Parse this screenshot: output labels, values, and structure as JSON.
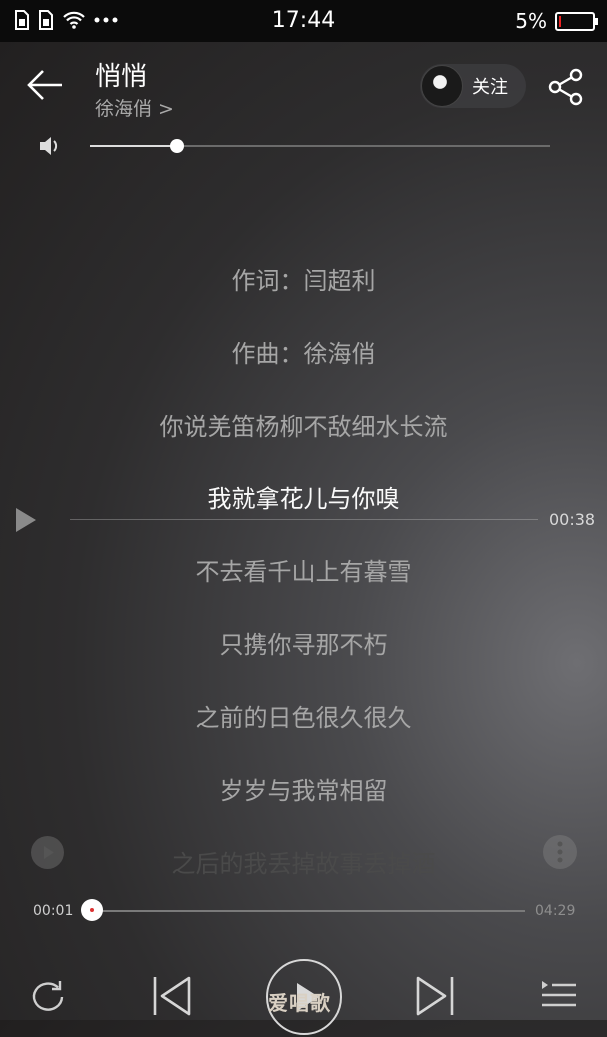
{
  "status_bar": {
    "time": "17:44",
    "battery": "5%"
  },
  "song": {
    "title": "悄悄",
    "artist": "徐海俏 >"
  },
  "header": {
    "follow_label": "关注"
  },
  "volume": {
    "level": 0.19
  },
  "lyrics": [
    "作词：闫超利",
    "作曲：徐海俏",
    "你说羌笛杨柳不敌细水长流",
    "我就拿花儿与你嗅",
    "不去看千山上有暮雪",
    "只携你寻那不朽",
    "之前的日色很久很久",
    "岁岁与我常相留",
    "之后的我丢掉故事丢掉酒"
  ],
  "seek": {
    "time": "00:38"
  },
  "progress": {
    "current": "00:01",
    "total": "04:29",
    "fraction": 0.0
  },
  "watermark": "爱唱歌",
  "icons": {
    "back": "back-arrow-icon",
    "share": "share-icon",
    "volume": "speaker-icon",
    "repeat": "repeat-icon",
    "previous": "previous-icon",
    "next": "next-icon",
    "playlist": "playlist-icon"
  }
}
